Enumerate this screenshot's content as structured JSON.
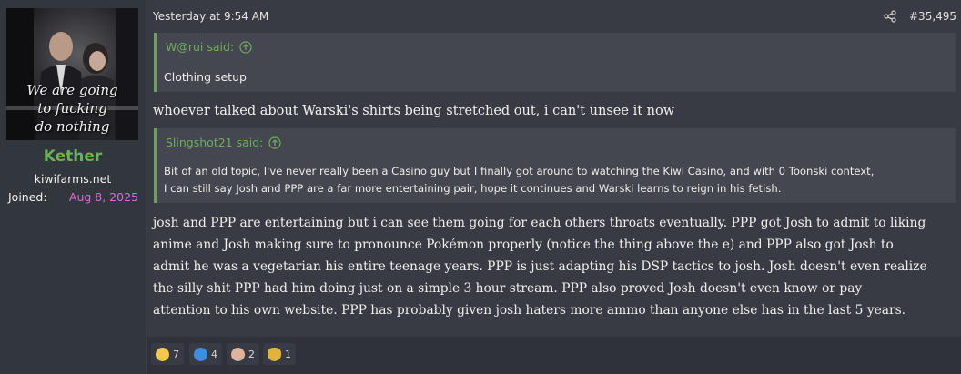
{
  "user": {
    "avatar_caption": [
      "We are going",
      "to fucking",
      "do nothing"
    ],
    "name": "Kether",
    "title": "kiwifarms.net",
    "joined_label": "Joined:",
    "joined_date": "Aug 8, 2025",
    "name_color": "#6bb35a",
    "joined_color": "#d86bd6"
  },
  "post": {
    "timestamp": "Yesterday at 9:54 AM",
    "number": "#35,495",
    "quotes": [
      {
        "author": "W@rui said:",
        "body": "Clothing setup"
      },
      {
        "author": "Slingshot21 said:",
        "body_lines": [
          "Bit of an old topic, I've never really been a Casino guy but I finally got around to watching the Kiwi Casino, and with 0 Toonski context,",
          "I can still say Josh and PPP are a far more entertaining pair, hope it continues and Warski learns to reign in his fetish."
        ]
      }
    ],
    "reply1": "whoever talked about Warski's shirts being stretched out, i can't unsee it now",
    "reply2_lines": [
      "josh and PPP are entertaining but i can see them going for each others throats eventually. PPP got Josh to admit to liking",
      "anime and Josh making sure to pronounce Pokémon properly (notice the thing above the e) and PPP also got Josh to",
      "admit he was a vegetarian his entire teenage years. PPP is just adapting his DSP tactics to josh. Josh doesn't even realize",
      "the silly shit PPP had him doing just on a simple 3 hour stream. PPP also proved Josh doesn't even know or pay",
      "attention to his own website. PPP has probably given josh haters more ammo than anyone else has in the last 5 years."
    ]
  },
  "reactions": [
    {
      "icon": "thinking-face-icon",
      "count": "7"
    },
    {
      "icon": "thumbs-up-icon",
      "count": "4"
    },
    {
      "icon": "face-icon",
      "count": "2"
    },
    {
      "icon": "pineapple-icon",
      "count": "1"
    }
  ],
  "accent": "#69a356"
}
